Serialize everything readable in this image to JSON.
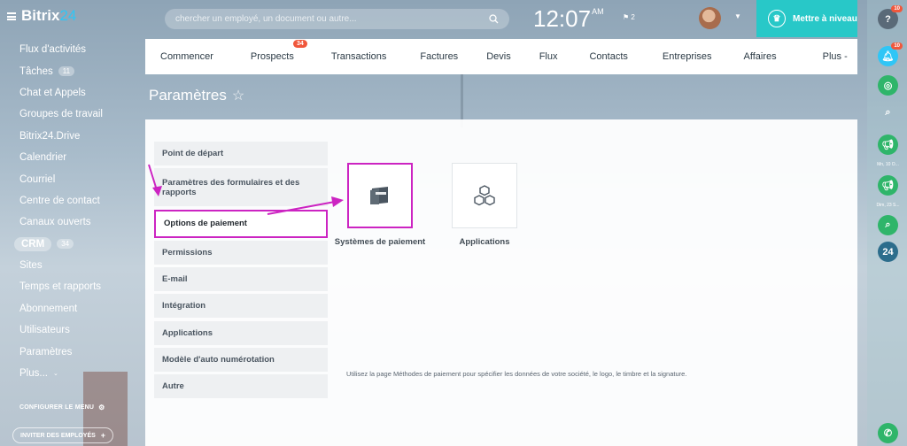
{
  "brand": {
    "name": "Bitrix",
    "suffix": "24"
  },
  "search": {
    "placeholder": "chercher un employé, un document ou autre..."
  },
  "clock": {
    "time": "12:07",
    "ampm": "AM"
  },
  "flag_count": "2",
  "upgrade_label": "Mettre à niveau",
  "sidebar": {
    "items": [
      {
        "label": "Flux d'activités"
      },
      {
        "label": "Tâches",
        "badge": "11"
      },
      {
        "label": "Chat et Appels"
      },
      {
        "label": "Groupes de travail"
      },
      {
        "label": "Bitrix24.Drive"
      },
      {
        "label": "Calendrier"
      },
      {
        "label": "Courriel"
      },
      {
        "label": "Centre de contact"
      },
      {
        "label": "Canaux ouverts"
      },
      {
        "label": "CRM",
        "badge": "34"
      },
      {
        "label": "Sites"
      },
      {
        "label": "Temps et rapports"
      },
      {
        "label": "Abonnement"
      },
      {
        "label": "Utilisateurs"
      },
      {
        "label": "Paramètres"
      },
      {
        "label": "Plus..."
      }
    ],
    "configure_label": "CONFIGURER LE MENU",
    "invite_label": "INVITER DES EMPLOYÉS"
  },
  "tabs": [
    {
      "label": "Commencer"
    },
    {
      "label": "Prospects",
      "badge": "34"
    },
    {
      "label": "Transactions"
    },
    {
      "label": "Factures"
    },
    {
      "label": "Devis"
    },
    {
      "label": "Flux"
    },
    {
      "label": "Contacts"
    },
    {
      "label": "Entreprises"
    },
    {
      "label": "Affaires"
    },
    {
      "label": "Plus -"
    }
  ],
  "page_title": "Paramètres",
  "settings": [
    {
      "label": "Point de départ"
    },
    {
      "label": "Paramètres des formulaires et des rapports"
    },
    {
      "label": "Options de paiement"
    },
    {
      "label": "Permissions"
    },
    {
      "label": "E-mail"
    },
    {
      "label": "Intégration"
    },
    {
      "label": "Applications"
    },
    {
      "label": "Modèle d'auto numérotation"
    },
    {
      "label": "Autre"
    }
  ],
  "tiles": [
    {
      "label": "Systèmes de paiement",
      "icon": "wallet-icon"
    },
    {
      "label": "Applications",
      "icon": "cubes-icon"
    }
  ],
  "help_text": "Utilisez la page Méthodes de paiement pour spécifier les données de votre société, le logo, le timbre et la signature.",
  "rail": {
    "help_badge": "10",
    "notif_badge": "10",
    "date1": "Mn, 10 O...",
    "date2": "Dim, 23 S..."
  },
  "colors": {
    "highlight": "#cc24c2",
    "accent_teal": "#28c8c8",
    "rail_green": "#2fb56a",
    "badge_red": "#f0573c"
  }
}
